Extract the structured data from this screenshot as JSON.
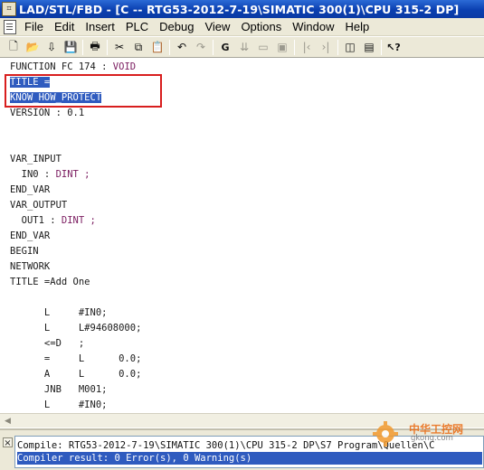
{
  "window": {
    "title": "LAD/STL/FBD  - [C -- RTG53-2012-7-19\\SIMATIC 300(1)\\CPU 315-2 DP]",
    "icon": "lad-stl-fbd-app-icon"
  },
  "menu": {
    "items": [
      {
        "label": "File"
      },
      {
        "label": "Edit"
      },
      {
        "label": "Insert"
      },
      {
        "label": "PLC"
      },
      {
        "label": "Debug"
      },
      {
        "label": "View"
      },
      {
        "label": "Options"
      },
      {
        "label": "Window"
      },
      {
        "label": "Help"
      }
    ]
  },
  "toolbar": {
    "buttons": [
      {
        "icon": "new-document-icon",
        "glyph": "🗋"
      },
      {
        "icon": "open-folder-icon",
        "glyph": "📂"
      },
      {
        "icon": "compile-icon",
        "glyph": "⇩"
      },
      {
        "icon": "save-icon",
        "glyph": "💾"
      },
      {
        "icon": "print-icon",
        "glyph": "🖶"
      },
      {
        "icon": "cut-icon",
        "glyph": "✂"
      },
      {
        "icon": "copy-icon",
        "glyph": "⧉"
      },
      {
        "icon": "paste-icon",
        "glyph": "📋"
      },
      {
        "icon": "undo-icon",
        "glyph": "↶"
      },
      {
        "icon": "redo-icon",
        "glyph": "↷"
      },
      {
        "icon": "monitor-icon",
        "glyph": "G"
      },
      {
        "icon": "download-icon",
        "glyph": "⇊"
      },
      {
        "icon": "offline-icon",
        "glyph": "▭"
      },
      {
        "icon": "online-icon",
        "glyph": "▣"
      },
      {
        "icon": "bookmark-prev-icon",
        "glyph": "|‹"
      },
      {
        "icon": "bookmark-next-icon",
        "glyph": "›|"
      },
      {
        "icon": "overview-icon",
        "glyph": "◫"
      },
      {
        "icon": "details-icon",
        "glyph": "▤"
      },
      {
        "icon": "whats-this-help-icon",
        "glyph": "↖?"
      }
    ]
  },
  "editor": {
    "lines": [
      "FUNCTION FC 174 : ",
      "TITLE =",
      "KNOW_HOW_PROTECT",
      "VERSION : 0.1",
      "",
      "",
      "VAR_INPUT",
      "  IN0 : ",
      "END_VAR",
      "VAR_OUTPUT",
      "  OUT1 : ",
      "END_VAR",
      "BEGIN",
      "NETWORK",
      "TITLE =Add One",
      "",
      "      L     #IN0;",
      "      L     L#94608000;",
      "      <=D   ;",
      "      =     L      0.0;",
      "      A     L      0.0;",
      "      JNB   M001;",
      "      L     #IN0;"
    ],
    "types": {
      "line0": "VOID",
      "line7": "DINT ;",
      "line10": "DINT ;"
    }
  },
  "output": {
    "compile_line": "Compile: RTG53-2012-7-19\\SIMATIC 300(1)\\CPU 315-2 DP\\S7 Program\\Quellen\\C",
    "result_line": "Compiler result: 0 Error(s), 0 Warning(s)"
  },
  "watermark": {
    "text": "中华工控网",
    "sub": "gkong.com"
  },
  "colors": {
    "titlebar": "#0a3fb0",
    "selection": "#2f5bbf",
    "annotation": "#d81e1e",
    "keyword_type": "#7a1b5f"
  }
}
